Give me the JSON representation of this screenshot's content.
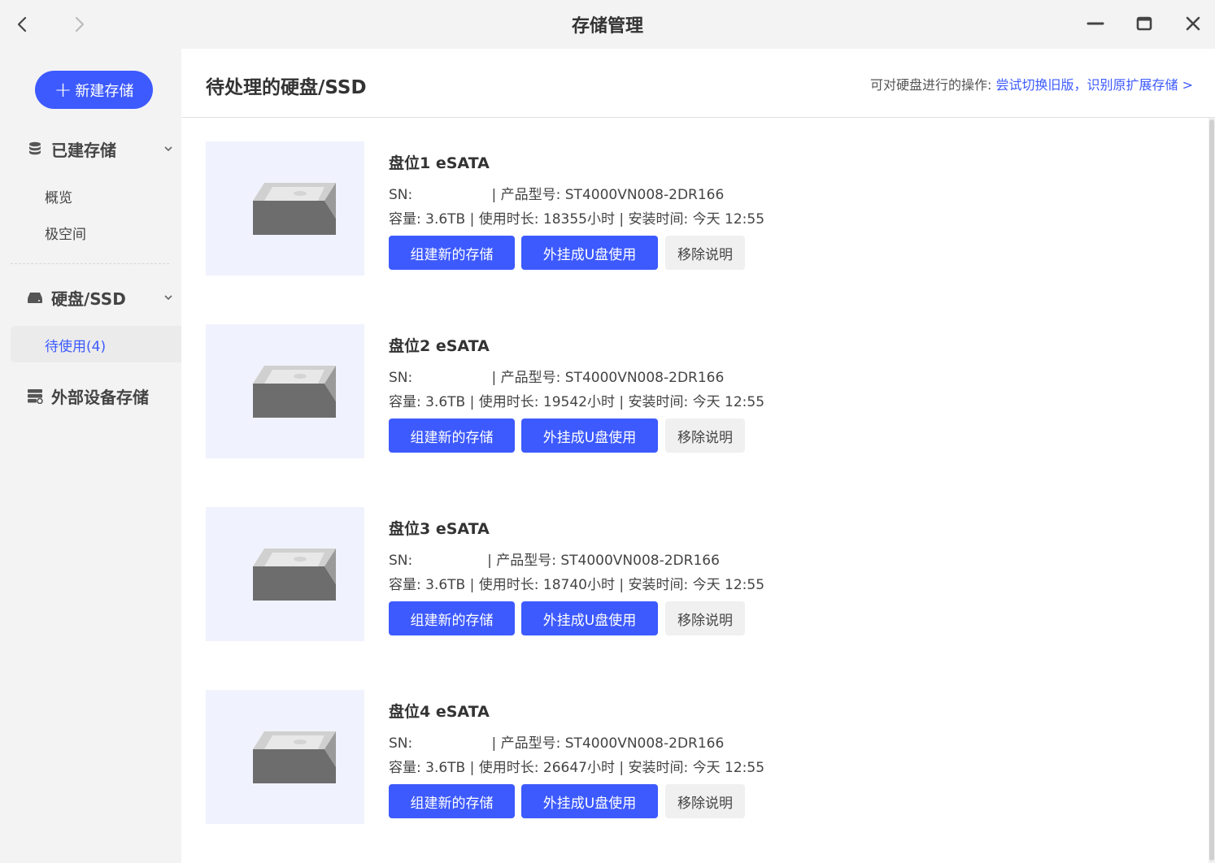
{
  "window": {
    "title": "存储管理"
  },
  "sidebar": {
    "new_button": "新建存储",
    "sections": {
      "built": "已建存储",
      "disks": "硬盘/SSD",
      "external": "外部设备存储"
    },
    "built_items": [
      "概览",
      "极空间"
    ],
    "disks_items": [
      "待使用(4)"
    ]
  },
  "main": {
    "title": "待处理的硬盘/SSD",
    "ops_label": "可对硬盘进行的操作:",
    "ops_link": "尝试切换旧版，识别原扩展存储 >"
  },
  "buttons": {
    "create": "组建新的存储",
    "usb": "外挂成U盘使用",
    "remove": "移除说明"
  },
  "disks": [
    {
      "name": "盘位1 eSATA",
      "sn_line": "SN:                  | 产品型号: ST4000VN008-2DR166",
      "info_line": "容量: 3.6TB | 使用时长: 18355小时 | 安装时间: 今天 12:55"
    },
    {
      "name": "盘位2 eSATA",
      "sn_line": "SN:                  | 产品型号: ST4000VN008-2DR166",
      "info_line": "容量: 3.6TB | 使用时长: 19542小时 | 安装时间: 今天 12:55"
    },
    {
      "name": "盘位3 eSATA",
      "sn_line": "SN:                 | 产品型号: ST4000VN008-2DR166",
      "info_line": "容量: 3.6TB | 使用时长: 18740小时 | 安装时间: 今天 12:55"
    },
    {
      "name": "盘位4 eSATA",
      "sn_line": "SN:                  | 产品型号: ST4000VN008-2DR166",
      "info_line": "容量: 3.6TB | 使用时长: 26647小时 | 安装时间: 今天 12:55"
    }
  ]
}
